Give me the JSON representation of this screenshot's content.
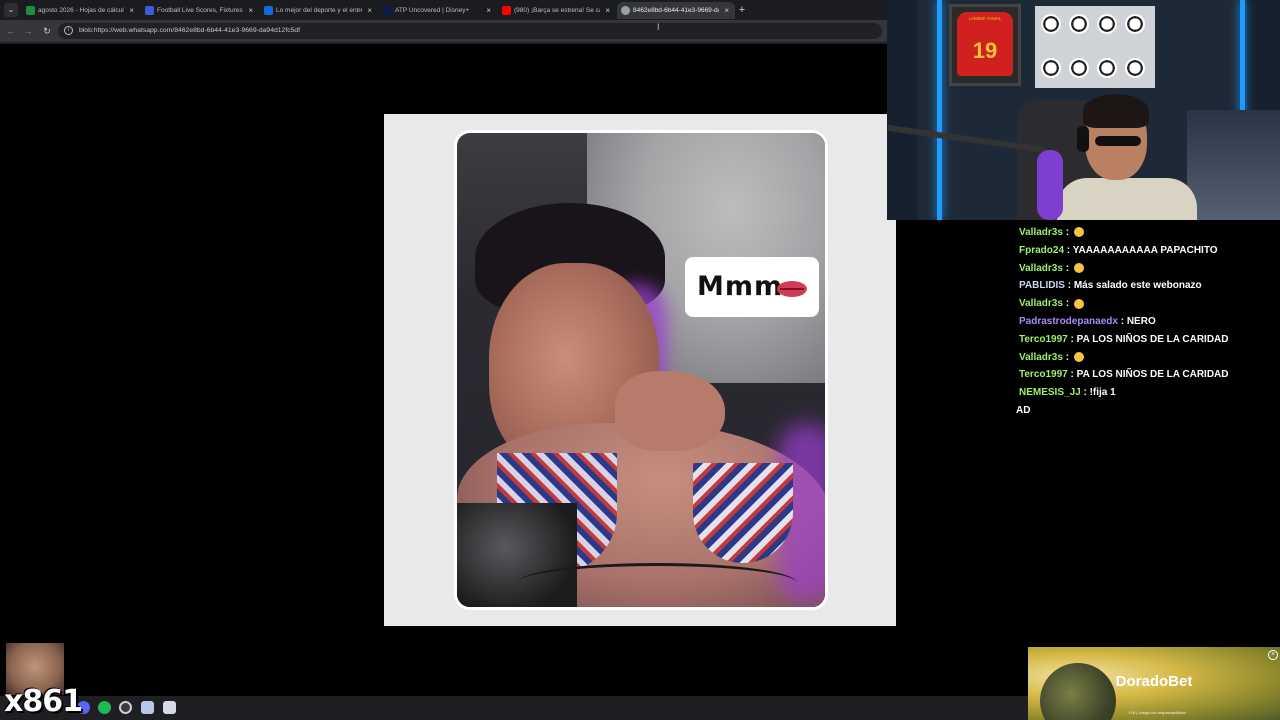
{
  "browser": {
    "tabs": [
      {
        "label": "agosto 2026 - Hojas de cálculo",
        "favicon_color": "#1e8e3e",
        "active": false
      },
      {
        "label": "Football Live Scores, Fixtures &",
        "favicon_color": "#3b5bdb",
        "active": false
      },
      {
        "label": "Lo mejor del deporte y el entretenimiento",
        "favicon_color": "#1668e3",
        "active": false
      },
      {
        "label": "ATP Uncovered | Disney+",
        "favicon_color": "#0b1d4d",
        "active": false
      },
      {
        "label": "(980) ¡Barça se estrena! Se cae",
        "favicon_color": "#ff0000",
        "active": false
      },
      {
        "label": "8462e8bd-6b44-41e3-9669-da94d12fc5df",
        "favicon_color": "#9aa0a6",
        "active": true
      }
    ],
    "close_glyph": "×",
    "newtab_glyph": "+",
    "url": "blob:https://web.whatsapp.com/8462e8bd-6b44-41e3-9669-da94d12fc5df"
  },
  "image_viewer": {
    "sticker_text": "Mmm"
  },
  "chat": {
    "messages": [
      {
        "user": "Valladr3s",
        "user_color": "#9ef06e",
        "text": " : "
      },
      {
        "user": "Fprado24",
        "user_color": "#9ef06e",
        "text": " : YAAAAAAAAAAA PAPACHITO"
      },
      {
        "user": "Valladr3s",
        "user_color": "#9ef06e",
        "text": " : "
      },
      {
        "user": "PABLIDIS",
        "user_color": "#c9d7f2",
        "text": " : Más salado este webonazo"
      },
      {
        "user": "Valladr3s",
        "user_color": "#9ef06e",
        "text": " : "
      },
      {
        "user": "Padrastrodepanaedx",
        "user_color": "#a78bfa",
        "text": " : NERO"
      },
      {
        "user": "Terco1997",
        "user_color": "#9ef06e",
        "text": " : PA LOS NIÑOS DE LA CARIDAD"
      },
      {
        "user": "Valladr3s",
        "user_color": "#9ef06e",
        "text": " : "
      },
      {
        "user": "Terco1997",
        "user_color": "#9ef06e",
        "text": " : PA LOS NIÑOS DE LA CARIDAD"
      },
      {
        "user": "NEMESIS_JJ",
        "user_color": "#9ef06e",
        "text": " : !fija 1"
      },
      {
        "user": "",
        "user_color": "#ffffff",
        "text": "AD"
      }
    ]
  },
  "overlay": {
    "counter_text": "x861",
    "jersey_number": "19",
    "jersey_name": "LAMINE YAMAL"
  },
  "ad": {
    "brand": "DoradoBet",
    "fine_print": "+18 | Juega con responsabilidad",
    "close_glyph": "×"
  },
  "taskbar": {
    "icons": [
      "discord-icon",
      "spotify-icon",
      "obs-icon",
      "notepad-icon",
      "app-icon"
    ]
  }
}
